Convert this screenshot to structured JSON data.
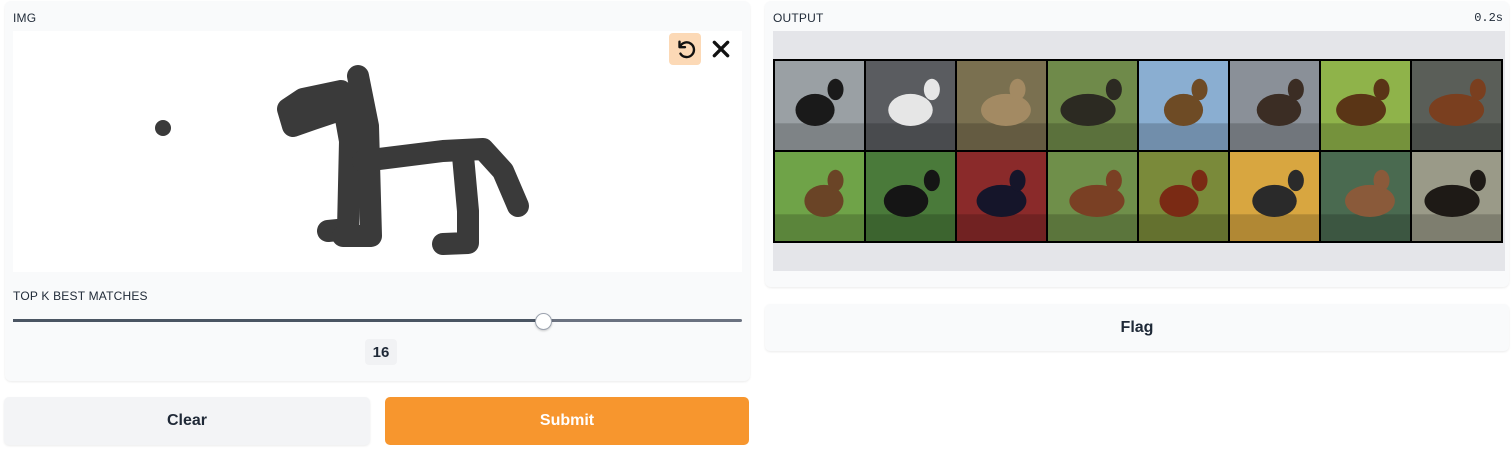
{
  "input": {
    "label": "IMG",
    "undo_icon": "undo-icon",
    "clear_icon": "close-icon"
  },
  "slider": {
    "label": "TOP K BEST MATCHES",
    "value": "16",
    "fraction": 0.727
  },
  "buttons": {
    "clear": "Clear",
    "submit": "Submit",
    "flag": "Flag"
  },
  "output": {
    "label": "OUTPUT",
    "time": "0.2s",
    "tiles": [
      {
        "name": "dog-black",
        "bg": "#9aa0a4",
        "subject": "#1a1a1a"
      },
      {
        "name": "cat-white",
        "bg": "#5a5c60",
        "subject": "#e6e6e6"
      },
      {
        "name": "cat-tabby",
        "bg": "#7a7050",
        "subject": "#a38a63"
      },
      {
        "name": "dog-doberman",
        "bg": "#6f8a4a",
        "subject": "#2c2a22"
      },
      {
        "name": "dog-shepherd",
        "bg": "#8aaed1",
        "subject": "#6e4b25"
      },
      {
        "name": "horse-dark",
        "bg": "#8a9098",
        "subject": "#3b2d24"
      },
      {
        "name": "horse-brown",
        "bg": "#8fb34a",
        "subject": "#5a3516"
      },
      {
        "name": "horse-chestnut",
        "bg": "#5a5e58",
        "subject": "#7a3f1f"
      },
      {
        "name": "horse-field",
        "bg": "#6fa348",
        "subject": "#6a4426"
      },
      {
        "name": "bird-black",
        "bg": "#4a7a3a",
        "subject": "#151515"
      },
      {
        "name": "horse-red-bg",
        "bg": "#8a2a2a",
        "subject": "#15152a"
      },
      {
        "name": "horse-rider",
        "bg": "#6f8f4a",
        "subject": "#7a4024"
      },
      {
        "name": "horse-running",
        "bg": "#7a8a3a",
        "subject": "#7a2a14"
      },
      {
        "name": "bird-flying",
        "bg": "#d8a640",
        "subject": "#2a2a2a"
      },
      {
        "name": "cat-indoor",
        "bg": "#4a6a50",
        "subject": "#8a5a3a"
      },
      {
        "name": "horse-black",
        "bg": "#9a9a88",
        "subject": "#1e1a16"
      }
    ]
  }
}
